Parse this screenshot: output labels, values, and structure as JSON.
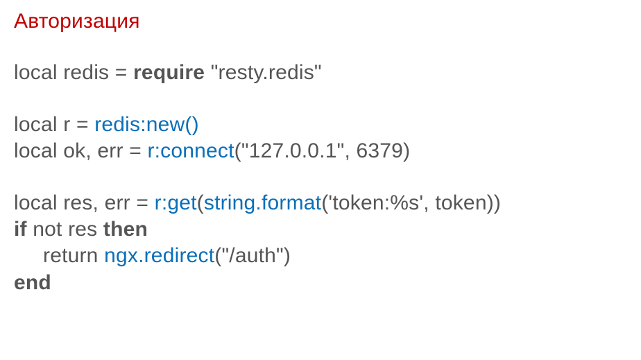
{
  "title": "Авторизация",
  "block1": {
    "l1_a": "local redis = ",
    "l1_b": "require",
    "l1_c": " \"resty.redis\""
  },
  "block2": {
    "l1_a": "local r = ",
    "l1_b": "redis:new()",
    "l2_a": "local ok, err = ",
    "l2_b": "r:connect",
    "l2_c": "(\"127.0.0.1\", 6379)"
  },
  "block3": {
    "l1_a": "local res, err = ",
    "l1_b": "r:get",
    "l1_c": "(",
    "l1_d": "string.format",
    "l1_e": "('token:%s', token))",
    "l2_a": "if",
    "l2_b": " not res ",
    "l2_c": "then",
    "l3_a": "return ",
    "l3_b": "ngx.redirect",
    "l3_c": "(\"/auth\")",
    "l4_a": "end"
  }
}
